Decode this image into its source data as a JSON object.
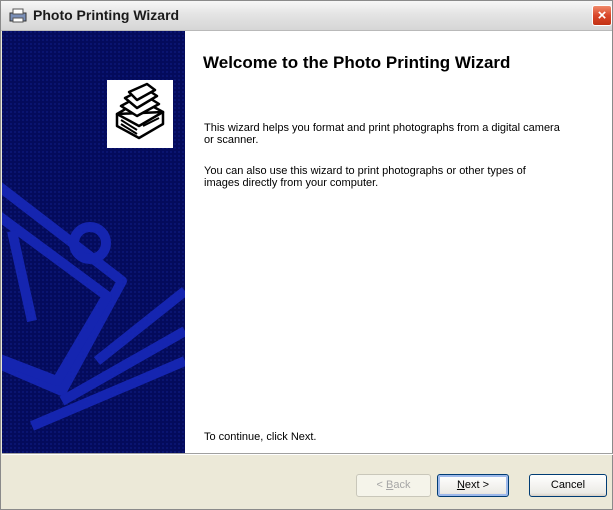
{
  "window": {
    "title": "Photo Printing Wizard",
    "close_label": "×"
  },
  "content": {
    "heading": "Welcome to the Photo Printing Wizard",
    "paragraph1": "This wizard helps you format and print photographs from a digital camera or scanner.",
    "paragraph2": "You can also use this wizard to print photographs or other types of images directly from your computer.",
    "instruction": "To continue, click Next."
  },
  "buttons": {
    "back": {
      "prefix": "< ",
      "mnemonic": "B",
      "rest": "ack",
      "enabled": false
    },
    "next": {
      "mnemonic": "N",
      "rest": "ext >",
      "enabled": true
    },
    "cancel": "Cancel"
  },
  "colors": {
    "sidebar": "#040b5c",
    "sidebar_art": "#1525b0",
    "accent": "#003c74"
  }
}
